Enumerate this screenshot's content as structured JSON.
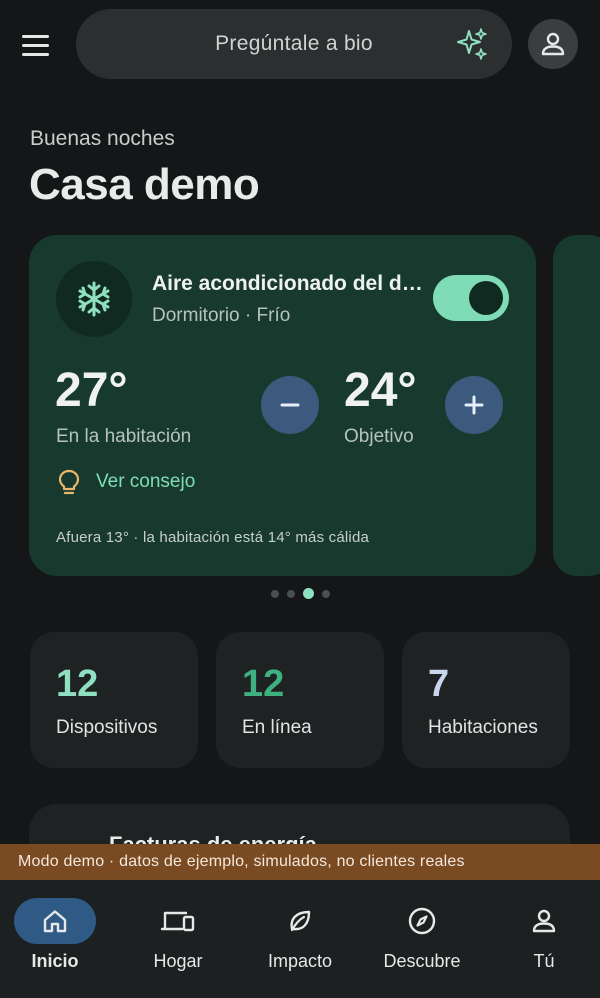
{
  "search": {
    "label": "Pregúntale a bio"
  },
  "greeting": "Buenas noches",
  "home_title": "Casa demo",
  "ac_card": {
    "name": "Aire acondicionado del dormitorio",
    "subtitle": "Dormitorio · Frío",
    "power_on": true,
    "current_temp": "27°",
    "current_label": "En la habitación",
    "target_temp": "24°",
    "target_label": "Objetivo",
    "tip_label": "Ver consejo",
    "outside_note": "Afuera 13° · la habitación está 14° más cálida"
  },
  "carousel": {
    "count": 4,
    "active_index": 2
  },
  "stats": [
    {
      "value": "12",
      "label": "Dispositivos",
      "color": "#8fe0c0"
    },
    {
      "value": "12",
      "label": "En línea",
      "color": "#3fb07f"
    },
    {
      "value": "7",
      "label": "Habitaciones",
      "color": "#c9d6ee"
    }
  ],
  "energy_card": {
    "title": "Facturas de energía"
  },
  "demo_banner": "Modo demo · datos de ejemplo, simulados, no clientes reales",
  "nav": [
    {
      "label": "Inicio",
      "icon": "home-icon",
      "active": true
    },
    {
      "label": "Hogar",
      "icon": "devices-icon",
      "active": false
    },
    {
      "label": "Impacto",
      "icon": "leaf-icon",
      "active": false
    },
    {
      "label": "Descubre",
      "icon": "compass-icon",
      "active": false
    },
    {
      "label": "Tú",
      "icon": "person-icon",
      "active": false
    }
  ],
  "colors": {
    "background": "#141617",
    "card_green": "#183a2e",
    "accent_mint": "#7fdcb6",
    "button_blue": "#3c5a7e",
    "banner_brown": "#7a4a22",
    "nav_active": "#2f5a86"
  }
}
